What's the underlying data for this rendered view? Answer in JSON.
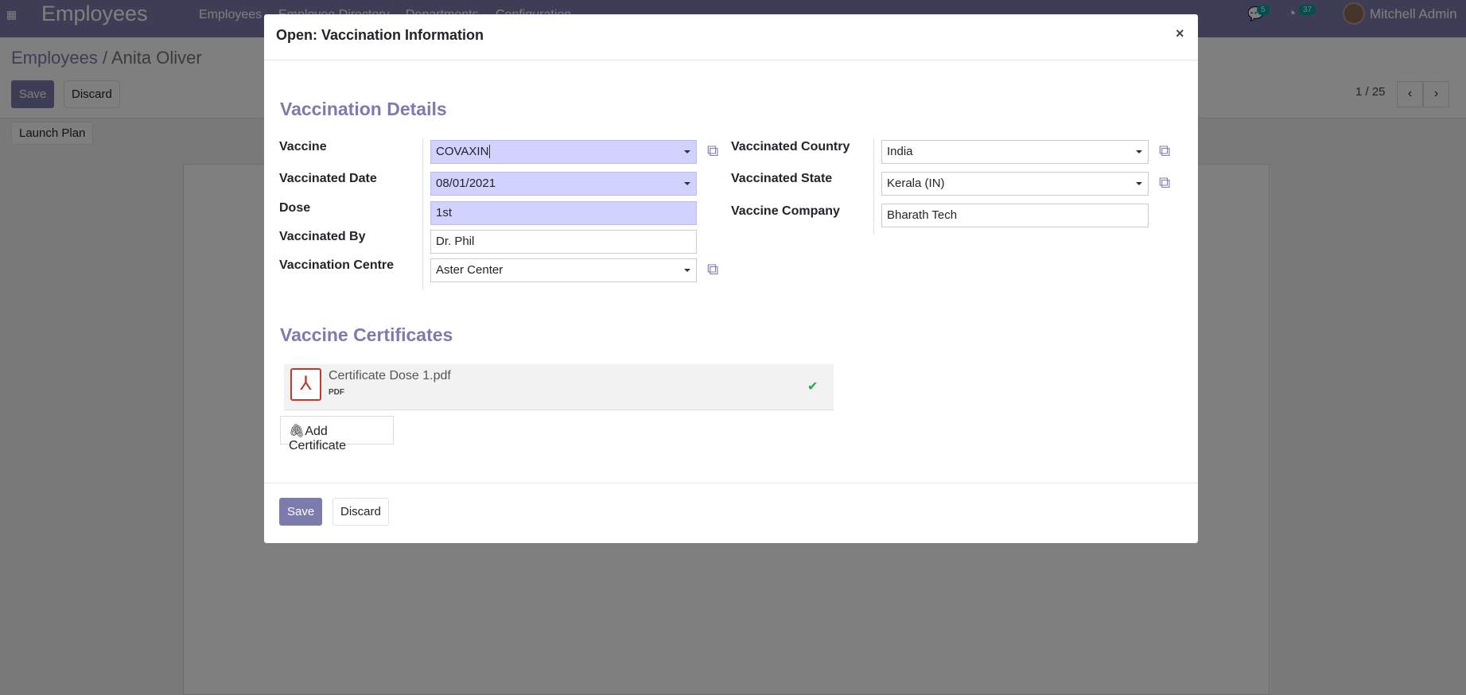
{
  "topbar": {
    "app_name": "Employees",
    "menu": [
      "Employees",
      "Employee Directory",
      "Departments",
      "Configuration"
    ],
    "messages_count": "5",
    "activities_count": "37",
    "user": "Mitchell Admin"
  },
  "control_panel": {
    "breadcrumb_root": "Employees",
    "breadcrumb_sep": "/",
    "breadcrumb_current": "Anita Oliver",
    "save": "Save",
    "discard": "Discard",
    "launch_plan": "Launch Plan",
    "pager": "1 / 25"
  },
  "modal": {
    "title": "Open: Vaccination Information",
    "close": "×",
    "section_details": "Vaccination Details",
    "fields": {
      "vaccine_label": "Vaccine",
      "vaccine_value": "COVAXIN",
      "date_label": "Vaccinated Date",
      "date_value": "08/01/2021",
      "dose_label": "Dose",
      "dose_value": "1st",
      "by_label": "Vaccinated By",
      "by_value": "Dr. Phil",
      "centre_label": "Vaccination Centre",
      "centre_value": "Aster Center",
      "country_label": "Vaccinated Country",
      "country_value": "India",
      "state_label": "Vaccinated State",
      "state_value": "Kerala (IN)",
      "company_label": "Vaccine Company",
      "company_value": "Bharath Tech"
    },
    "section_certs": "Vaccine Certificates",
    "attachment": {
      "name": "Certificate Dose 1.pdf",
      "ext": "PDF"
    },
    "add_certificate": "Add Certificate",
    "save": "Save",
    "discard": "Discard"
  },
  "icons": {
    "external": "external-link-icon",
    "pdf": "pdf-icon",
    "check": "check-icon",
    "paperclip": "paperclip-icon"
  },
  "colors": {
    "brand": "#7c7bad",
    "required": "#d2d2ff",
    "ok": "#28a745"
  }
}
